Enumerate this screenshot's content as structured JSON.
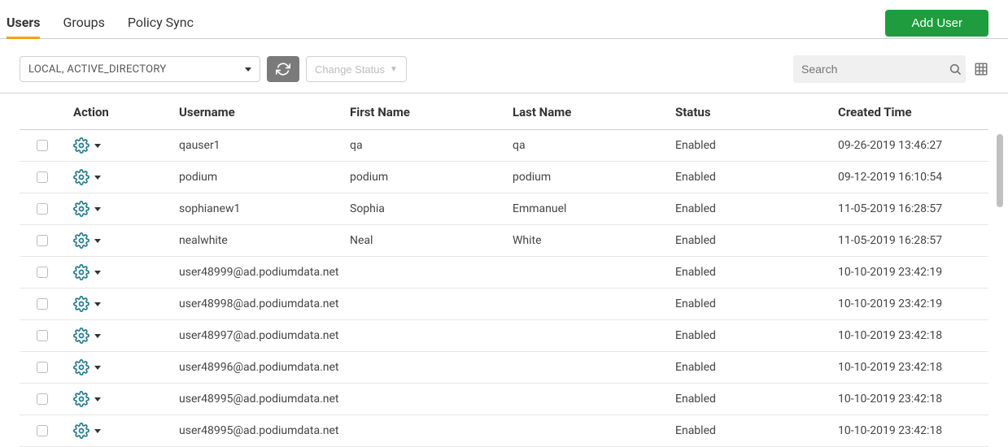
{
  "tabs": {
    "users": "Users",
    "groups": "Groups",
    "policy_sync": "Policy Sync",
    "active": "users"
  },
  "buttons": {
    "add_user": "Add User",
    "change_status": "Change Status"
  },
  "filter": {
    "value": "LOCAL,  ACTIVE_DIRECTORY"
  },
  "search": {
    "placeholder": "Search"
  },
  "columns": {
    "action": "Action",
    "username": "Username",
    "first_name": "First Name",
    "last_name": "Last Name",
    "status": "Status",
    "created_time": "Created Time"
  },
  "rows": [
    {
      "username": "qauser1",
      "first_name": "qa",
      "last_name": "qa",
      "status": "Enabled",
      "created_time": "09-26-2019 13:46:27"
    },
    {
      "username": "podium",
      "first_name": "podium",
      "last_name": "podium",
      "status": "Enabled",
      "created_time": "09-12-2019 16:10:54"
    },
    {
      "username": "sophianew1",
      "first_name": "Sophia",
      "last_name": "Emmanuel",
      "status": "Enabled",
      "created_time": "11-05-2019 16:28:57"
    },
    {
      "username": "nealwhite",
      "first_name": "Neal",
      "last_name": "White",
      "status": "Enabled",
      "created_time": "11-05-2019  16:28:57"
    },
    {
      "username": "user48999@ad.podiumdata.net",
      "first_name": "",
      "last_name": "",
      "status": "Enabled",
      "created_time": "10-10-2019 23:42:19"
    },
    {
      "username": "user48998@ad.podiumdata.net",
      "first_name": "",
      "last_name": "",
      "status": "Enabled",
      "created_time": "10-10-2019 23:42:19"
    },
    {
      "username": "user48997@ad.podiumdata.net",
      "first_name": "",
      "last_name": "",
      "status": "Enabled",
      "created_time": "10-10-2019 23:42:18"
    },
    {
      "username": "user48996@ad.podiumdata.net",
      "first_name": "",
      "last_name": "",
      "status": "Enabled",
      "created_time": "10-10-2019 23:42:18"
    },
    {
      "username": "user48995@ad.podiumdata.net",
      "first_name": "",
      "last_name": "",
      "status": "Enabled",
      "created_time": "10-10-2019 23:42:18"
    },
    {
      "username": "user48995@ad.podiumdata.net",
      "first_name": "",
      "last_name": "",
      "status": "Enabled",
      "created_time": "10-10-2019 23:42:18"
    }
  ]
}
